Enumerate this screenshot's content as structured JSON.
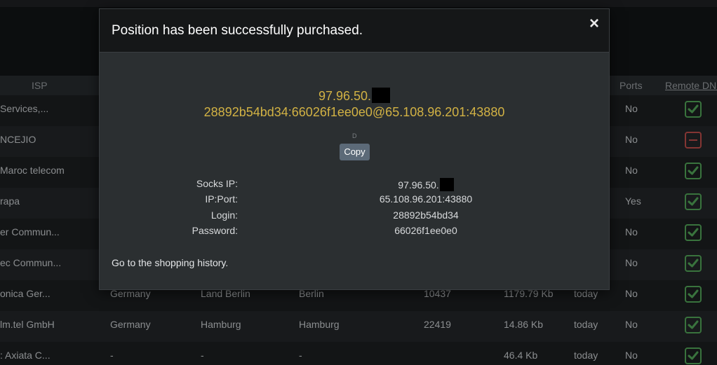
{
  "table": {
    "headers": {
      "isp": "ISP",
      "ports": "Ports",
      "remote_dns": "Remote DNS"
    },
    "rows": [
      {
        "isp": "Services,...",
        "country": "",
        "region": "",
        "city": "",
        "zip": "",
        "speed": "",
        "time": "",
        "ports": "No",
        "remote": "check"
      },
      {
        "isp": "NCEJIO",
        "country": "",
        "region": "",
        "city": "",
        "zip": "",
        "speed": "",
        "time": "",
        "ports": "No",
        "remote": "minus"
      },
      {
        "isp": "Maroc telecom",
        "country": "",
        "region": "",
        "city": "",
        "zip": "",
        "speed": "",
        "time": "",
        "ports": "No",
        "remote": "check"
      },
      {
        "isp": "rapa",
        "country": "",
        "region": "",
        "city": "",
        "zip": "",
        "speed": "",
        "time": "",
        "ports": "Yes",
        "remote": "check"
      },
      {
        "isp": "er Commun...",
        "country": "",
        "region": "",
        "city": "",
        "zip": "",
        "speed": "",
        "time": "",
        "ports": "No",
        "remote": "check"
      },
      {
        "isp": "ec Commun...",
        "country": "",
        "region": "",
        "city": "",
        "zip": "",
        "speed": "",
        "time": "",
        "ports": "No",
        "remote": "check"
      },
      {
        "isp": "onica Ger...",
        "country": "Germany",
        "region": "Land Berlin",
        "city": "Berlin",
        "zip": "10437",
        "speed": "1179.79 Kb",
        "time": "today",
        "ports": "No",
        "remote": "check"
      },
      {
        "isp": "lm.tel GmbH",
        "country": "Germany",
        "region": "Hamburg",
        "city": "Hamburg",
        "zip": "22419",
        "speed": "14.86 Kb",
        "time": "today",
        "ports": "No",
        "remote": "check"
      },
      {
        "isp": ": Axiata C...",
        "country": "-",
        "region": "-",
        "city": "-",
        "zip": "",
        "speed": "46.4 Kb",
        "time": "today",
        "ports": "No",
        "remote": "check"
      }
    ]
  },
  "modal": {
    "title": "Position has been successfully purchased.",
    "close_label": "×",
    "proxy_ip_prefix": "97.96.50.",
    "proxy_string": "28892b54bd34:66026f1ee0e0@65.108.96.201:43880",
    "tiny_mark": "D",
    "copy_label": "Copy",
    "fields": [
      {
        "label": "Socks IP:",
        "value": "97.96.50.",
        "redacted": true
      },
      {
        "label": "IP:Port:",
        "value": "65.108.96.201:43880",
        "redacted": false
      },
      {
        "label": "Login:",
        "value": "28892b54bd34",
        "redacted": false
      },
      {
        "label": "Password:",
        "value": "66026f1ee0e0",
        "redacted": false
      }
    ],
    "history_link": "Go to the shopping history."
  },
  "colors": {
    "accent_gold": "#d2b244",
    "check_green": "#4c9a52",
    "minus_red": "#b14744",
    "copy_button": "#5c6a78"
  }
}
